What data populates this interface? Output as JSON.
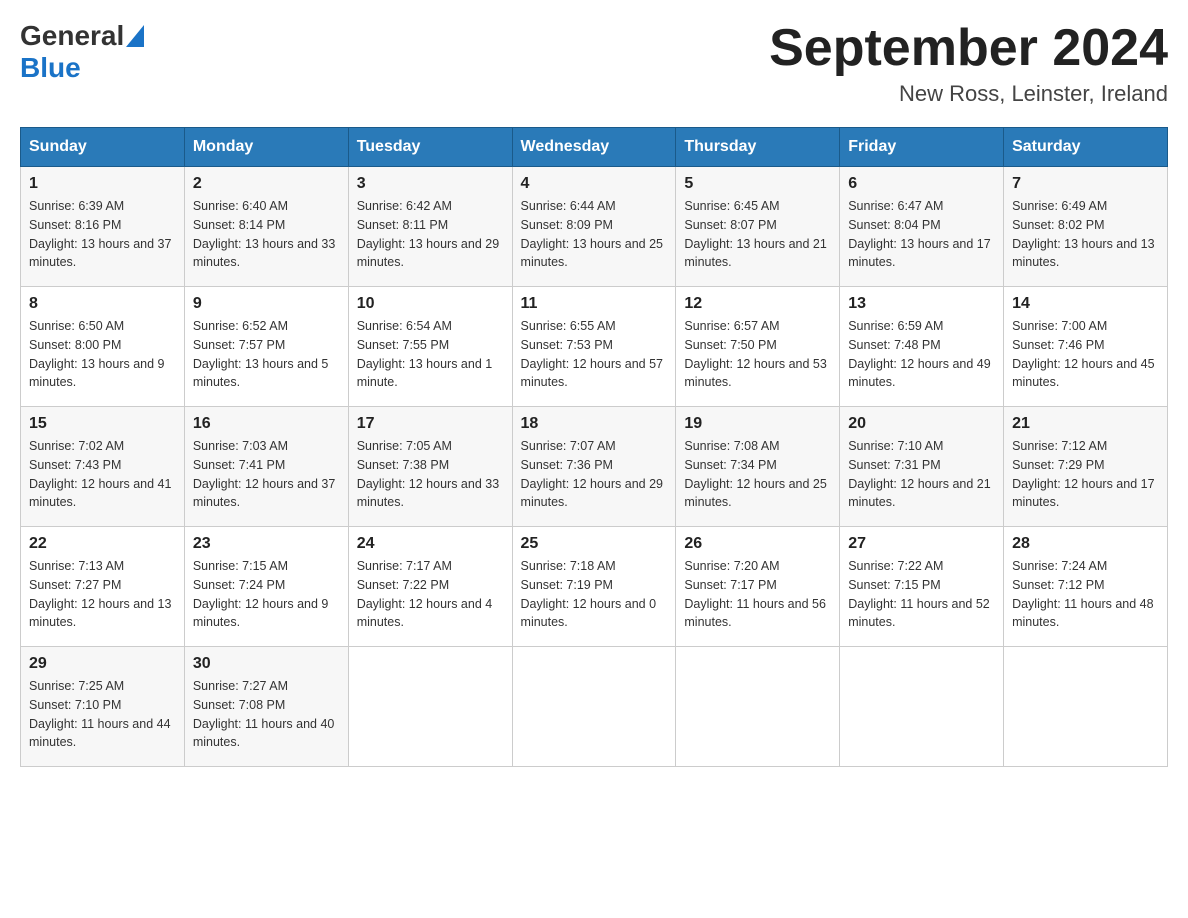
{
  "header": {
    "logo_general": "General",
    "logo_blue": "Blue",
    "month_title": "September 2024",
    "location": "New Ross, Leinster, Ireland"
  },
  "days_of_week": [
    "Sunday",
    "Monday",
    "Tuesday",
    "Wednesday",
    "Thursday",
    "Friday",
    "Saturday"
  ],
  "weeks": [
    [
      {
        "day": "1",
        "sunrise": "6:39 AM",
        "sunset": "8:16 PM",
        "daylight": "13 hours and 37 minutes."
      },
      {
        "day": "2",
        "sunrise": "6:40 AM",
        "sunset": "8:14 PM",
        "daylight": "13 hours and 33 minutes."
      },
      {
        "day": "3",
        "sunrise": "6:42 AM",
        "sunset": "8:11 PM",
        "daylight": "13 hours and 29 minutes."
      },
      {
        "day": "4",
        "sunrise": "6:44 AM",
        "sunset": "8:09 PM",
        "daylight": "13 hours and 25 minutes."
      },
      {
        "day": "5",
        "sunrise": "6:45 AM",
        "sunset": "8:07 PM",
        "daylight": "13 hours and 21 minutes."
      },
      {
        "day": "6",
        "sunrise": "6:47 AM",
        "sunset": "8:04 PM",
        "daylight": "13 hours and 17 minutes."
      },
      {
        "day": "7",
        "sunrise": "6:49 AM",
        "sunset": "8:02 PM",
        "daylight": "13 hours and 13 minutes."
      }
    ],
    [
      {
        "day": "8",
        "sunrise": "6:50 AM",
        "sunset": "8:00 PM",
        "daylight": "13 hours and 9 minutes."
      },
      {
        "day": "9",
        "sunrise": "6:52 AM",
        "sunset": "7:57 PM",
        "daylight": "13 hours and 5 minutes."
      },
      {
        "day": "10",
        "sunrise": "6:54 AM",
        "sunset": "7:55 PM",
        "daylight": "13 hours and 1 minute."
      },
      {
        "day": "11",
        "sunrise": "6:55 AM",
        "sunset": "7:53 PM",
        "daylight": "12 hours and 57 minutes."
      },
      {
        "day": "12",
        "sunrise": "6:57 AM",
        "sunset": "7:50 PM",
        "daylight": "12 hours and 53 minutes."
      },
      {
        "day": "13",
        "sunrise": "6:59 AM",
        "sunset": "7:48 PM",
        "daylight": "12 hours and 49 minutes."
      },
      {
        "day": "14",
        "sunrise": "7:00 AM",
        "sunset": "7:46 PM",
        "daylight": "12 hours and 45 minutes."
      }
    ],
    [
      {
        "day": "15",
        "sunrise": "7:02 AM",
        "sunset": "7:43 PM",
        "daylight": "12 hours and 41 minutes."
      },
      {
        "day": "16",
        "sunrise": "7:03 AM",
        "sunset": "7:41 PM",
        "daylight": "12 hours and 37 minutes."
      },
      {
        "day": "17",
        "sunrise": "7:05 AM",
        "sunset": "7:38 PM",
        "daylight": "12 hours and 33 minutes."
      },
      {
        "day": "18",
        "sunrise": "7:07 AM",
        "sunset": "7:36 PM",
        "daylight": "12 hours and 29 minutes."
      },
      {
        "day": "19",
        "sunrise": "7:08 AM",
        "sunset": "7:34 PM",
        "daylight": "12 hours and 25 minutes."
      },
      {
        "day": "20",
        "sunrise": "7:10 AM",
        "sunset": "7:31 PM",
        "daylight": "12 hours and 21 minutes."
      },
      {
        "day": "21",
        "sunrise": "7:12 AM",
        "sunset": "7:29 PM",
        "daylight": "12 hours and 17 minutes."
      }
    ],
    [
      {
        "day": "22",
        "sunrise": "7:13 AM",
        "sunset": "7:27 PM",
        "daylight": "12 hours and 13 minutes."
      },
      {
        "day": "23",
        "sunrise": "7:15 AM",
        "sunset": "7:24 PM",
        "daylight": "12 hours and 9 minutes."
      },
      {
        "day": "24",
        "sunrise": "7:17 AM",
        "sunset": "7:22 PM",
        "daylight": "12 hours and 4 minutes."
      },
      {
        "day": "25",
        "sunrise": "7:18 AM",
        "sunset": "7:19 PM",
        "daylight": "12 hours and 0 minutes."
      },
      {
        "day": "26",
        "sunrise": "7:20 AM",
        "sunset": "7:17 PM",
        "daylight": "11 hours and 56 minutes."
      },
      {
        "day": "27",
        "sunrise": "7:22 AM",
        "sunset": "7:15 PM",
        "daylight": "11 hours and 52 minutes."
      },
      {
        "day": "28",
        "sunrise": "7:24 AM",
        "sunset": "7:12 PM",
        "daylight": "11 hours and 48 minutes."
      }
    ],
    [
      {
        "day": "29",
        "sunrise": "7:25 AM",
        "sunset": "7:10 PM",
        "daylight": "11 hours and 44 minutes."
      },
      {
        "day": "30",
        "sunrise": "7:27 AM",
        "sunset": "7:08 PM",
        "daylight": "11 hours and 40 minutes."
      },
      null,
      null,
      null,
      null,
      null
    ]
  ]
}
